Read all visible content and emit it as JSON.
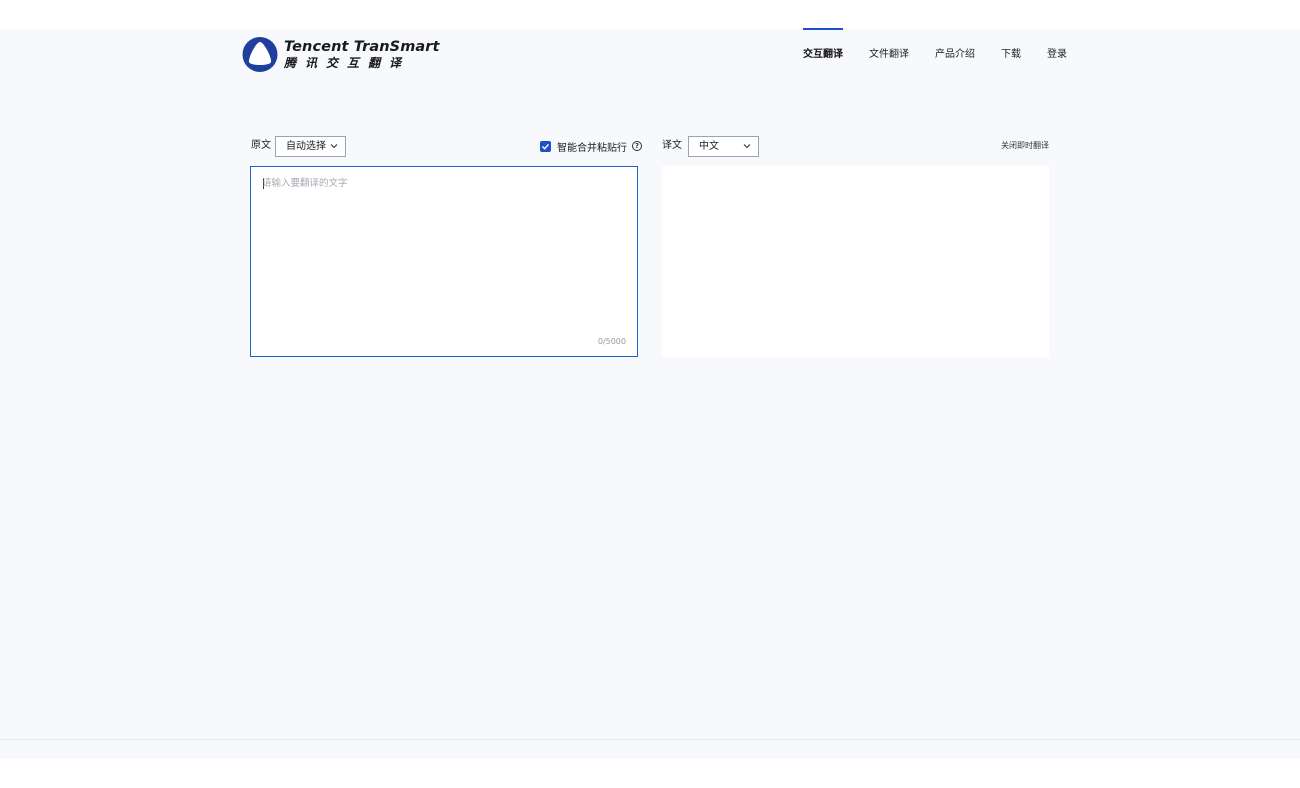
{
  "brand": {
    "name_en": "Tencent TranSmart",
    "name_cn": "腾讯交互翻译",
    "color": "#1e50c8"
  },
  "nav": {
    "items": [
      {
        "label": "交互翻译",
        "active": true
      },
      {
        "label": "文件翻译",
        "active": false
      },
      {
        "label": "产品介绍",
        "active": false
      },
      {
        "label": "下载",
        "active": false
      },
      {
        "label": "登录",
        "active": false
      }
    ]
  },
  "source": {
    "label": "原文",
    "language": "自动选择",
    "placeholder": "请输入要翻译的文字",
    "value": "",
    "counter": "0/5000"
  },
  "options": {
    "merge_paste_label": "智能合并粘贴行",
    "merge_paste_checked": true,
    "help_icon": "question-circle-icon"
  },
  "target": {
    "label": "译文",
    "language": "中文",
    "close_instant_label": "关闭即时翻译"
  }
}
